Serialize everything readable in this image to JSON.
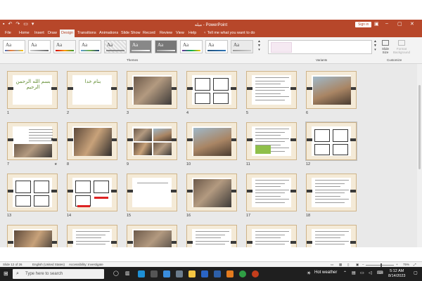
{
  "app": {
    "title": "PowerPoint",
    "doc_title": "میله",
    "sign_in": "Sign in",
    "quick_access": [
      "save-icon",
      "undo-icon",
      "redo-icon",
      "present-icon"
    ]
  },
  "tabs": [
    "File",
    "Home",
    "Insert",
    "Draw",
    "Design",
    "Transitions",
    "Animations",
    "Slide Show",
    "Record",
    "Review",
    "View",
    "Help"
  ],
  "active_tab": "Design",
  "tell_me": "Tell me what you want to do",
  "ribbon": {
    "theme_sample": "Aa",
    "themes_label": "Themes",
    "variants_label": "Variants",
    "customize_label": "Customize",
    "slide_size": "Slide Size",
    "format_background": "Format Background"
  },
  "slides": [
    {
      "num": "1",
      "calligraphy": "بسم الله الرحمن الرحیم"
    },
    {
      "num": "2",
      "calligraphy": "بنام خدا"
    },
    {
      "num": "3"
    },
    {
      "num": "4"
    },
    {
      "num": "5"
    },
    {
      "num": "6"
    },
    {
      "num": "7",
      "star": "★"
    },
    {
      "num": "8"
    },
    {
      "num": "9"
    },
    {
      "num": "10"
    },
    {
      "num": "11"
    },
    {
      "num": "12"
    },
    {
      "num": "13"
    },
    {
      "num": "14"
    },
    {
      "num": "15"
    },
    {
      "num": "16"
    },
    {
      "num": "17"
    },
    {
      "num": "18"
    },
    {
      "num": ""
    },
    {
      "num": ""
    },
    {
      "num": ""
    },
    {
      "num": ""
    },
    {
      "num": ""
    },
    {
      "num": ""
    }
  ],
  "status": {
    "slide_info": "Slide 12 of 26",
    "language": "English (United States)",
    "accessibility": "Accessibility: Investigate",
    "zoom": "75%"
  },
  "taskbar": {
    "search_placeholder": "Type here to search",
    "weather": "Hot weather",
    "time": "5:12 AM",
    "date": "8/14/2023"
  },
  "colors": {
    "accent": "#b7472a",
    "slide_frame": "#f4ead7",
    "taskbar": "#1f1f1f"
  }
}
